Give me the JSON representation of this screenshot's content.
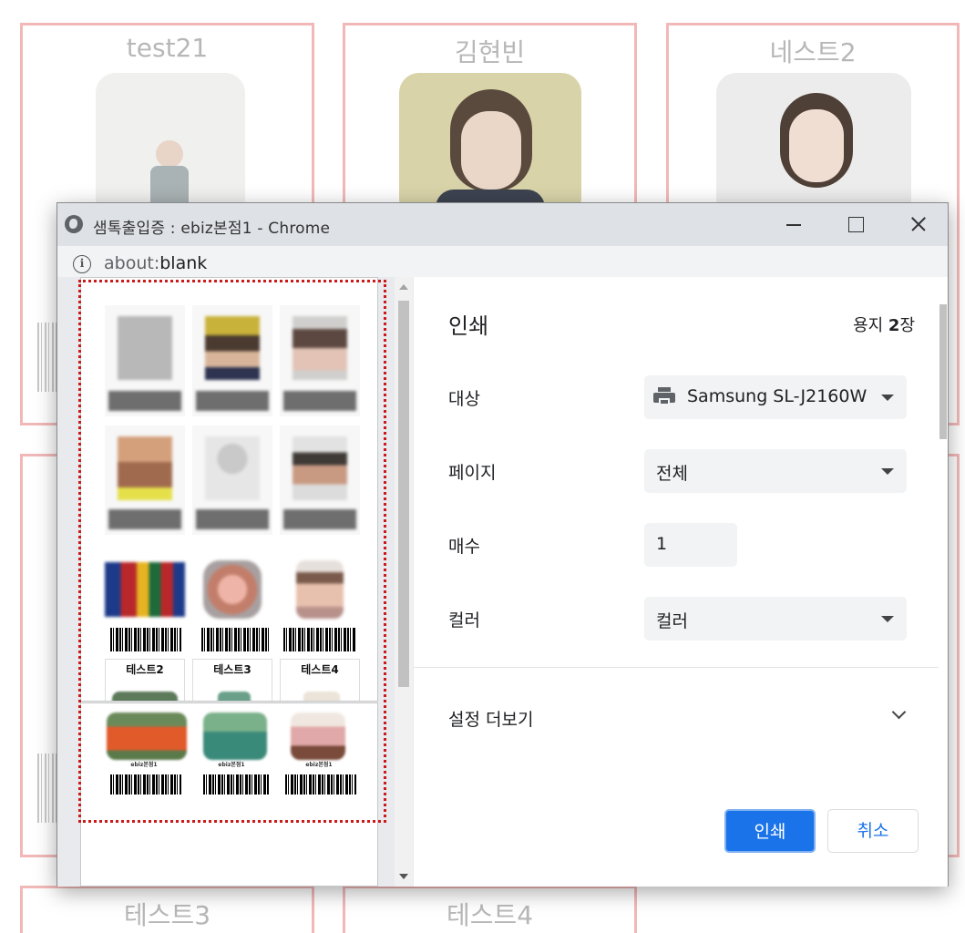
{
  "background_cards": {
    "card1_name": "test21",
    "card2_name": "김현빈",
    "card3_name": "네스트2",
    "card4_name": "테스트3",
    "card5_name": "테스트4"
  },
  "dialog": {
    "title": "샘톡출입증 : ebiz본점1 - Chrome",
    "url_dim": "about:",
    "url_main": "blank"
  },
  "preview": {
    "card_titles": [
      "테스트2",
      "테스트3",
      "테스트4"
    ],
    "branch_label": "ebiz본점1"
  },
  "settings": {
    "heading": "인쇄",
    "sheets_prefix": "용지 ",
    "sheets_count": "2",
    "sheets_suffix": "장",
    "destination_label": "대상",
    "destination_value": "Samsung SL-J2160W",
    "pages_label": "페이지",
    "pages_value": "전체",
    "copies_label": "매수",
    "copies_value": "1",
    "color_label": "컬러",
    "color_value": "컬러",
    "more_settings": "설정 더보기",
    "print_button": "인쇄",
    "cancel_button": "취소"
  },
  "colors": {
    "accent": "#1a73e8",
    "card_border": "#f2b8b8",
    "highlight_frame": "#cc1a1a"
  }
}
